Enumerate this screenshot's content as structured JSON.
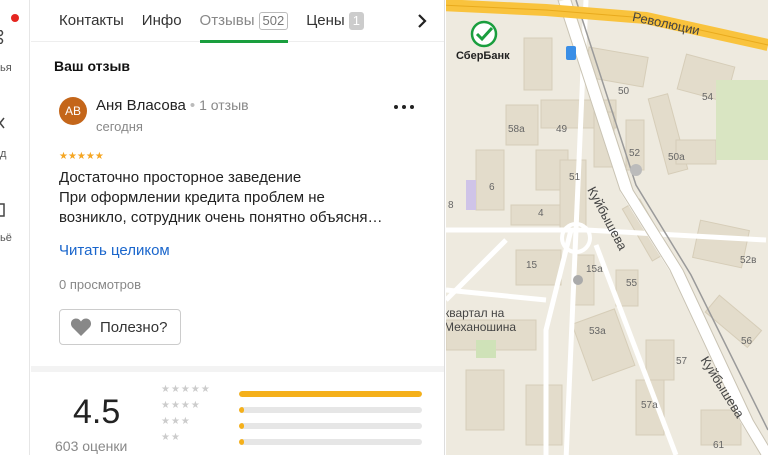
{
  "rail": {
    "items": [
      {
        "label": "ья"
      },
      {
        "label": "д"
      },
      {
        "label": "ьё"
      }
    ]
  },
  "tabs": [
    {
      "label": "Контакты",
      "count": ""
    },
    {
      "label": "Инфо",
      "count": ""
    },
    {
      "label": "Отзывы",
      "count": "502"
    },
    {
      "label": "Цены",
      "count": "1"
    }
  ],
  "review_section": {
    "title": "Ваш отзыв",
    "avatar_initials": "АВ",
    "author": "Аня Власова",
    "author_reviews": "1 отзыв",
    "date": "сегодня",
    "stars": "★★★★★",
    "text_lines": [
      "Достаточно просторное заведение",
      "При оформлении кредита проблем не",
      "возникло, сотрудник очень понятно объясня…"
    ],
    "read_more": "Читать целиком",
    "views": "0 просмотров",
    "useful_label": "Полезно?"
  },
  "rating": {
    "value": "4.5",
    "count_label": "603 оценки",
    "distribution": [
      {
        "stars": "★★★★★",
        "fraction": 1.0
      },
      {
        "stars": "★★★★",
        "fraction": 0.02
      },
      {
        "stars": "★★★",
        "fraction": 0.02
      },
      {
        "stars": "★★",
        "fraction": 0.02
      }
    ]
  },
  "map": {
    "poi_name": "СберБанк",
    "street_1": "Революции",
    "street_2": "Куйбышева",
    "street_3": "Куйбышева",
    "district": "квартал на",
    "district_2": "Механошина",
    "buildings": [
      "50",
      "54",
      "58а",
      "49",
      "52",
      "50а",
      "6",
      "51",
      "4",
      "8",
      "15",
      "15а",
      "55",
      "53а",
      "57",
      "57а",
      "61",
      "52в",
      "56"
    ],
    "colors": {
      "road": "#f9c33d",
      "background": "#eeeadf",
      "accent": "#1a9e3e"
    }
  }
}
